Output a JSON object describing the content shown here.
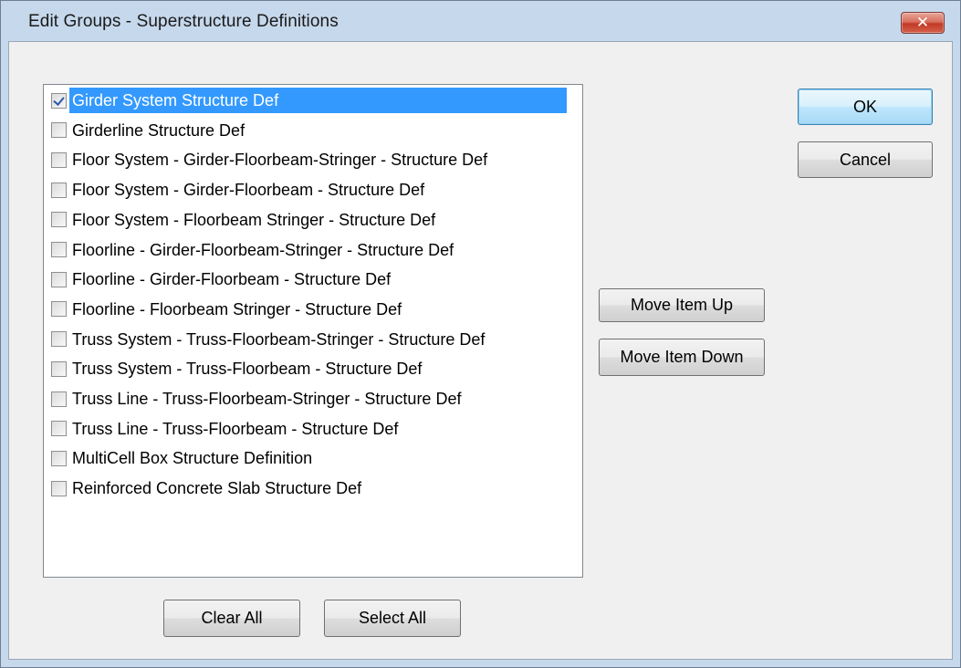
{
  "window": {
    "title": "Edit Groups - Superstructure Definitions",
    "close_glyph": "✕"
  },
  "list": {
    "items": [
      {
        "label": "Girder System Structure Def",
        "checked": true,
        "selected": true
      },
      {
        "label": "Girderline Structure Def",
        "checked": false,
        "selected": false
      },
      {
        "label": "Floor System -  Girder-Floorbeam-Stringer - Structure Def",
        "checked": false,
        "selected": false
      },
      {
        "label": "Floor System - Girder-Floorbeam - Structure Def",
        "checked": false,
        "selected": false
      },
      {
        "label": "Floor System - Floorbeam Stringer - Structure Def",
        "checked": false,
        "selected": false
      },
      {
        "label": "Floorline - Girder-Floorbeam-Stringer -  Structure Def",
        "checked": false,
        "selected": false
      },
      {
        "label": "Floorline - Girder-Floorbeam - Structure Def",
        "checked": false,
        "selected": false
      },
      {
        "label": "Floorline - Floorbeam Stringer - Structure Def",
        "checked": false,
        "selected": false
      },
      {
        "label": "Truss System -  Truss-Floorbeam-Stringer - Structure Def",
        "checked": false,
        "selected": false
      },
      {
        "label": "Truss System - Truss-Floorbeam - Structure Def",
        "checked": false,
        "selected": false
      },
      {
        "label": "Truss Line - Truss-Floorbeam-Stringer -  Structure Def",
        "checked": false,
        "selected": false
      },
      {
        "label": "Truss Line - Truss-Floorbeam - Structure Def",
        "checked": false,
        "selected": false
      },
      {
        "label": "MultiCell Box Structure Definition",
        "checked": false,
        "selected": false
      },
      {
        "label": "Reinforced Concrete Slab Structure Def",
        "checked": false,
        "selected": false
      }
    ]
  },
  "buttons": {
    "ok": "OK",
    "cancel": "Cancel",
    "move_up": "Move Item Up",
    "move_down": "Move Item Down",
    "clear_all": "Clear All",
    "select_all": "Select All"
  },
  "colors": {
    "selection": "#3399ff",
    "titlebar": "#c6d8ec",
    "close_button": "#c23a27"
  }
}
